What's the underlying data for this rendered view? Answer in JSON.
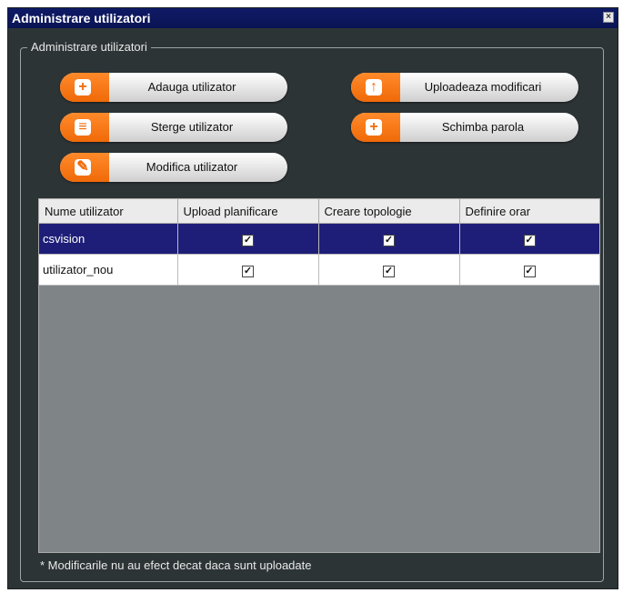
{
  "window": {
    "title": "Administrare utilizatori",
    "close_glyph": "×"
  },
  "group": {
    "label": "Administrare utilizatori"
  },
  "buttons": {
    "add": {
      "label": "Adauga utilizator",
      "icon": "plus-icon",
      "glyph": "+"
    },
    "delete": {
      "label": "Sterge utilizator",
      "icon": "trash-icon",
      "glyph": "≡"
    },
    "modify": {
      "label": "Modifica utilizator",
      "icon": "edit-icon",
      "glyph": "✎"
    },
    "upload": {
      "label": "Uploadeaza modificari",
      "icon": "upload-arrow-icon",
      "glyph": "↑"
    },
    "password": {
      "label": "Schimba parola",
      "icon": "plus-icon",
      "glyph": "+"
    }
  },
  "table": {
    "headers": [
      "Nume utilizator",
      "Upload planificare",
      "Creare topologie",
      "Definire orar"
    ],
    "rows": [
      {
        "name": "csvision",
        "upload": true,
        "topologie": true,
        "orar": true,
        "selected": true
      },
      {
        "name": "utilizator_nou",
        "upload": true,
        "topologie": true,
        "orar": true,
        "selected": false
      }
    ],
    "check_glyph": "✓"
  },
  "footnote": "* Modificarile nu au efect decat daca sunt uploadate",
  "colors": {
    "accent": "#f06a08",
    "titlebar": "#0f1a66",
    "selected_row": "#1e1e78",
    "background": "#2d3436"
  }
}
